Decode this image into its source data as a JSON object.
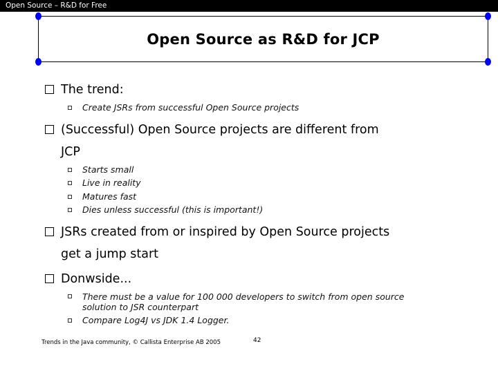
{
  "window": {
    "header_text": "Open Source – R&D for Free"
  },
  "slide": {
    "title": "Open Source as R&D for JCP",
    "bullets": [
      {
        "icon": "hollow-square-bullet",
        "lines": [
          "The trend:"
        ],
        "sub": [
          {
            "text": "Create JSRs from successful Open Source projects"
          }
        ]
      },
      {
        "icon": "hollow-square-bullet",
        "lines": [
          "(Successful) Open Source projects are different from",
          "JCP"
        ],
        "sub": [
          {
            "text": "Starts small"
          },
          {
            "text": "Live in reality"
          },
          {
            "text": "Matures fast"
          },
          {
            "text": "Dies unless successful (this is important!)"
          }
        ]
      },
      {
        "icon": "hollow-square-bullet",
        "lines": [
          "JSRs created from or inspired by Open Source projects",
          "get a jump start"
        ],
        "sub": []
      },
      {
        "icon": "hollow-square-bullet",
        "lines": [
          "Donwside..."
        ],
        "sub": [
          {
            "lines": [
              "There must be a value for 100 000 developers to switch from open source",
              "solution to JSR counterpart"
            ]
          },
          {
            "text": "Compare Log4J vs JDK 1.4 Logger."
          }
        ]
      }
    ]
  },
  "footer": {
    "text": "Trends in the Java community, © Callista Enterprise AB 2005",
    "page_number": "42"
  },
  "colors": {
    "header_bg": "#000000",
    "header_fg": "#ffffff",
    "selection_handle": "#0000ff"
  }
}
